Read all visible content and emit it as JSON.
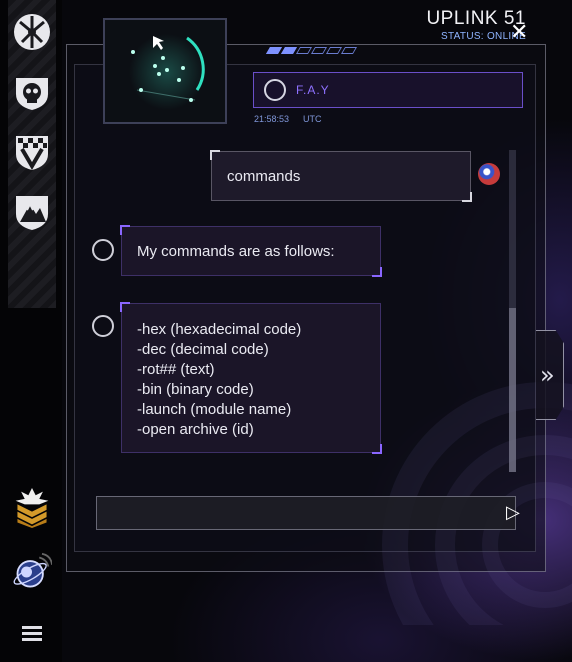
{
  "window": {
    "title": "UPLINK 51",
    "status": "STATUS: ONLINE",
    "close_glyph": "✕"
  },
  "sidebar": {
    "items": [
      {
        "icon": "faction-arrows-icon"
      },
      {
        "icon": "skull-shield-icon"
      },
      {
        "icon": "checkered-shield-icon"
      },
      {
        "icon": "mountain-shield-icon"
      }
    ],
    "bottom": [
      {
        "icon": "rank-chevrons-icon"
      },
      {
        "icon": "planet-uplink-icon"
      },
      {
        "icon": "menu-icon"
      }
    ]
  },
  "header": {
    "signal_segments": 6,
    "signal_active": 2
  },
  "contact": {
    "name": "F.A.Y",
    "time": "21:58:53",
    "timezone": "UTC"
  },
  "chat": {
    "user_message": "commands",
    "bot_intro": "My commands are as follows:",
    "command_list": [
      "-hex (hexadecimal code)",
      "-dec (decimal code)",
      "-rot## (text)",
      "-bin (binary code)",
      "-launch (module name)",
      "-open archive (id)"
    ]
  },
  "input": {
    "value": "",
    "placeholder": "",
    "send_glyph": "▷"
  },
  "side_tab": {
    "glyph": "»"
  },
  "colors": {
    "accent_purple": "#8a66ff",
    "status_blue": "#8fb4ff",
    "radar_teal": "#2fe0c0"
  }
}
